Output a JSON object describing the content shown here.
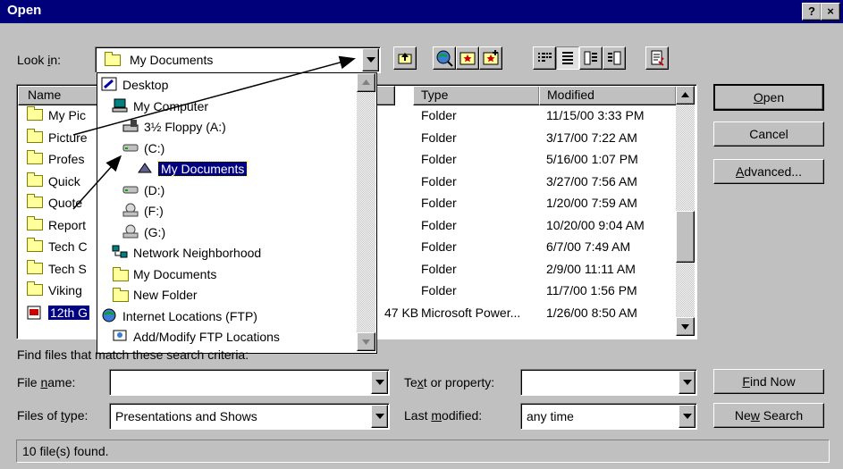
{
  "window": {
    "title": "Open",
    "help_btn": "?",
    "close_btn": "×"
  },
  "lookin": {
    "label_pre": "Look ",
    "label_u": "i",
    "label_post": "n:",
    "value": "My Documents"
  },
  "toolbar": [
    "up-one-level",
    "search-web",
    "favorites",
    "add-to-favorites",
    "list-view",
    "details-view",
    "properties-view",
    "preview-view",
    "commands-tools"
  ],
  "columns": {
    "name": "Name",
    "type": "Type",
    "modified": "Modified"
  },
  "files": [
    {
      "name": "My Pic",
      "type": "Folder",
      "modified": "11/15/00 3:33 PM"
    },
    {
      "name": "Picture",
      "type": "Folder",
      "modified": "3/17/00 7:22 AM"
    },
    {
      "name": "Profes",
      "type": "Folder",
      "modified": "5/16/00 1:07 PM"
    },
    {
      "name": "Quick ",
      "type": "Folder",
      "modified": "3/27/00 7:56 AM"
    },
    {
      "name": "Quote",
      "type": "Folder",
      "modified": "1/20/00 7:59 AM"
    },
    {
      "name": "Report",
      "type": "Folder",
      "modified": "10/20/00 9:04 AM"
    },
    {
      "name": "Tech C",
      "type": "Folder",
      "modified": "6/7/00 7:49 AM"
    },
    {
      "name": "Tech S",
      "type": "Folder",
      "modified": "2/9/00 11:11 AM"
    },
    {
      "name": "Viking",
      "type": "Folder",
      "modified": "11/7/00 1:56 PM"
    },
    {
      "name": "12th G",
      "size": "47 KB",
      "type": "Microsoft Power...",
      "modified": "1/26/00 8:50 AM"
    }
  ],
  "dropdown": [
    {
      "label": "Desktop",
      "icon": "desktop-icon"
    },
    {
      "label": "My Computer",
      "icon": "my-computer-icon"
    },
    {
      "label": "3½ Floppy (A:)",
      "icon": "floppy-drive-icon"
    },
    {
      "label": "(C:)",
      "icon": "hard-drive-icon"
    },
    {
      "label": "My Documents",
      "icon": "my-documents-folder-icon"
    },
    {
      "label": "(D:)",
      "icon": "hard-drive-icon"
    },
    {
      "label": "(F:)",
      "icon": "cd-drive-icon"
    },
    {
      "label": "(G:)",
      "icon": "cd-drive-icon"
    },
    {
      "label": "Network Neighborhood",
      "icon": "network-icon"
    },
    {
      "label": "My Documents",
      "icon": "folder-icon"
    },
    {
      "label": "New Folder",
      "icon": "folder-icon"
    },
    {
      "label": "Internet Locations (FTP)",
      "icon": "globe-icon"
    },
    {
      "label": "Add/Modify FTP Locations",
      "icon": "ftp-icon"
    }
  ],
  "buttons": {
    "open_u": "O",
    "open_rest": "pen",
    "cancel": "Cancel",
    "advanced_u": "A",
    "advanced_rest": "dvanced...",
    "findnow_u": "F",
    "findnow_rest": "ind Now",
    "newsearch_pre": "Ne",
    "newsearch_u": "w",
    "newsearch_post": " Search"
  },
  "search": {
    "caption": "Find files that match these search criteria:",
    "filename_pre": "File ",
    "filename_u": "n",
    "filename_post": "ame:",
    "filename_value": "",
    "filetype_pre": "Files of ",
    "filetype_u": "t",
    "filetype_post": "ype:",
    "filetype_value": "Presentations and Shows",
    "text_pre": "Te",
    "text_u": "x",
    "text_post": "t or property:",
    "text_value": "",
    "lastmod_pre": "Last ",
    "lastmod_u": "m",
    "lastmod_post": "odified:",
    "lastmod_value": "any time"
  },
  "status": "10 file(s) found.",
  "colors": {
    "title_bar": "#00007b",
    "selection": "#000080",
    "face": "#c0c0c0"
  }
}
